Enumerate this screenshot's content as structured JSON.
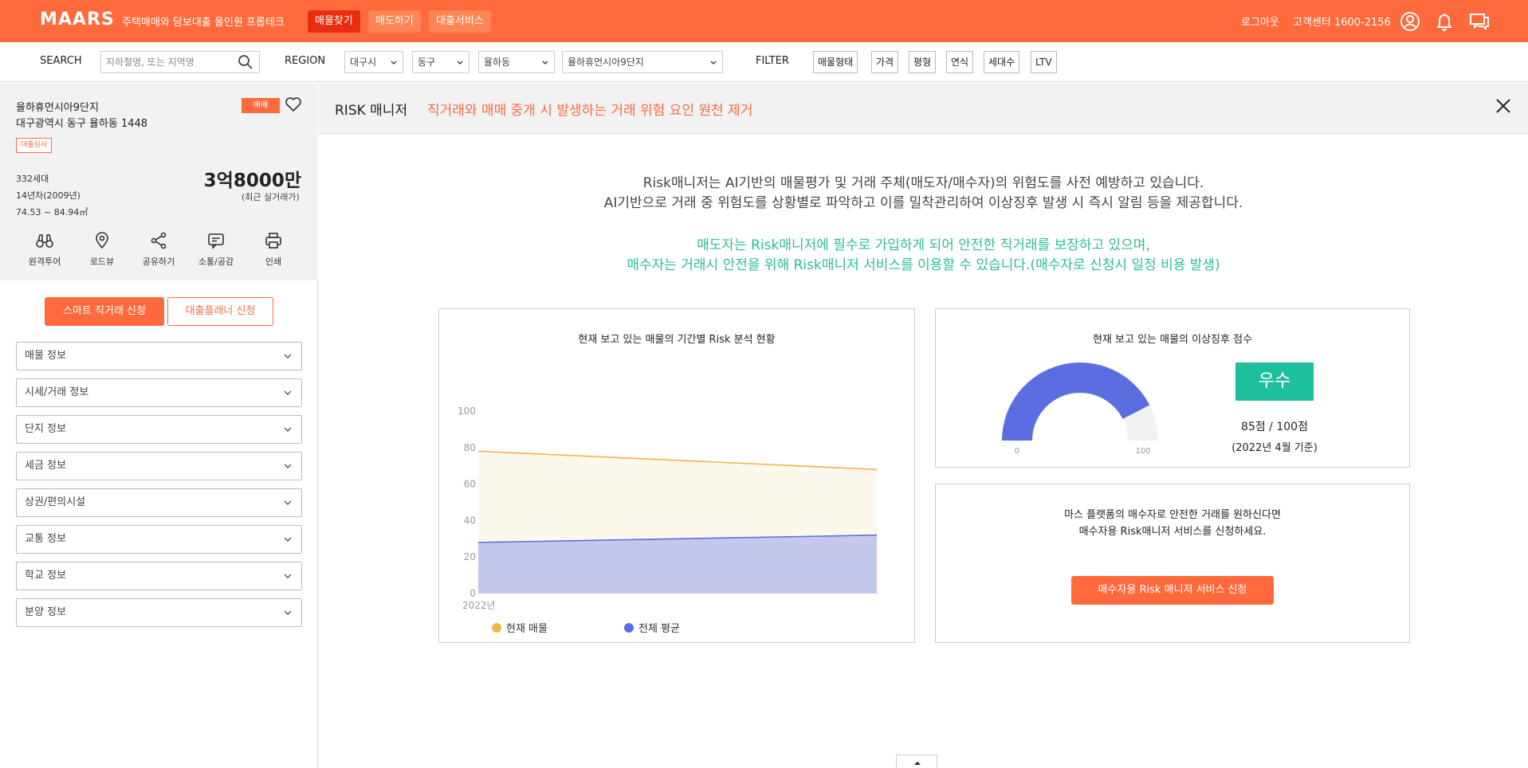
{
  "header": {
    "logo": "MAARS",
    "tagline": "주택매매와 담보대출 올인원 프롭테크",
    "nav": [
      "매물찾기",
      "매도하기",
      "대출서비스"
    ],
    "logout": "로그아웃",
    "support": "고객센터 1600-2156",
    "accent": "#ff6a3d"
  },
  "searchbar": {
    "search_label": "SEARCH",
    "search_placeholder": "지하철명, 또는 지역명",
    "region_label": "REGION",
    "city": "대구시",
    "district": "동구",
    "dong": "율하동",
    "complex": "율하휴먼시아9단지",
    "filter_label": "FILTER",
    "filters": [
      "매물형태",
      "가격",
      "평형",
      "연식",
      "세대수",
      "LTV"
    ]
  },
  "property": {
    "name": "율하휴먼시아9단지",
    "address": "대구광역시 동구 율하동 1448",
    "badge_loan": "대출심사",
    "badge_sale": "매매",
    "households": "332세대",
    "age": "14년차(2009년)",
    "area": "74.53 ~ 84.94㎡",
    "price": "3억8000만",
    "price_note": "(최근 실거래가)",
    "tools": [
      "원격투어",
      "로드뷰",
      "공유하기",
      "소통/공감",
      "인쇄"
    ]
  },
  "actions": {
    "smart": "스마트 직거래 신청",
    "planner": "대출플래너 신청"
  },
  "accordion": [
    "매물 정보",
    "시세/거래 정보",
    "단지 정보",
    "세금 정보",
    "상권/편의시설",
    "교통 정보",
    "학교 정보",
    "분양 정보"
  ],
  "main": {
    "title": "RISK 매니저",
    "subtitle": "직거래와 매매 중개 시 발생하는 거래 위험 요인 원천 제거",
    "intro1": "Risk매니저는 AI기반의 매물평가 및 거래 주체(매도자/매수자)의 위험도를 사전 예방하고 있습니다.",
    "intro2": "AI기반으로 거래 중 위험도를 상황별로 파악하고 이를 밀착관리하여 이상징후 발생 시 즉시 알림 등을 제공합니다.",
    "green1": "매도자는 Risk매니저에 필수로 가입하게 되어 안전한 직거래를 보장하고 있으며,",
    "green2": "매수자는 거래시 안전을 위해 Risk매니저 서비스를 이용할 수 있습니다.(매수자로 신청시 일정 비용 발생)",
    "green_color": "#2bbd99"
  },
  "risk_chart": {
    "title": "현재 보고 있는 매물의 기간별 Risk 분석 현황"
  },
  "score_card": {
    "title": "현재 보고 있는 매물의 이상징후 점수",
    "grade": "우수",
    "score": "85점 / 100점",
    "date": "(2022년 4월 기준)"
  },
  "buyer_card": {
    "line1": "마스 플랫폼의 매수자로 안전한 거래를 원하신다면",
    "line2": "매수자용 Risk매니저 서비스를 신청하세요.",
    "button": "매수자용 Risk 매니저 서비스 신청"
  },
  "chart_data": [
    {
      "type": "area",
      "x": [
        "2022년"
      ],
      "ylim": [
        0,
        100
      ],
      "yticks": [
        0,
        20,
        40,
        60,
        80,
        100
      ],
      "xlabel": "2022년",
      "legend_position": "bottom-left",
      "series": [
        {
          "name": "현재 매물",
          "color": "#f0b54a",
          "fill": "#fdf8ec",
          "start": 78,
          "end": 68
        },
        {
          "name": "전체 평균",
          "color": "#5b6ee1",
          "fill": "#c4c9ec",
          "start": 28,
          "end": 32
        }
      ]
    },
    {
      "type": "gauge",
      "value": 85,
      "min": 0,
      "max": 100,
      "min_label": "0",
      "max_label": "100",
      "color": "#5b6ee1",
      "track": "#f2f2f2"
    }
  ]
}
